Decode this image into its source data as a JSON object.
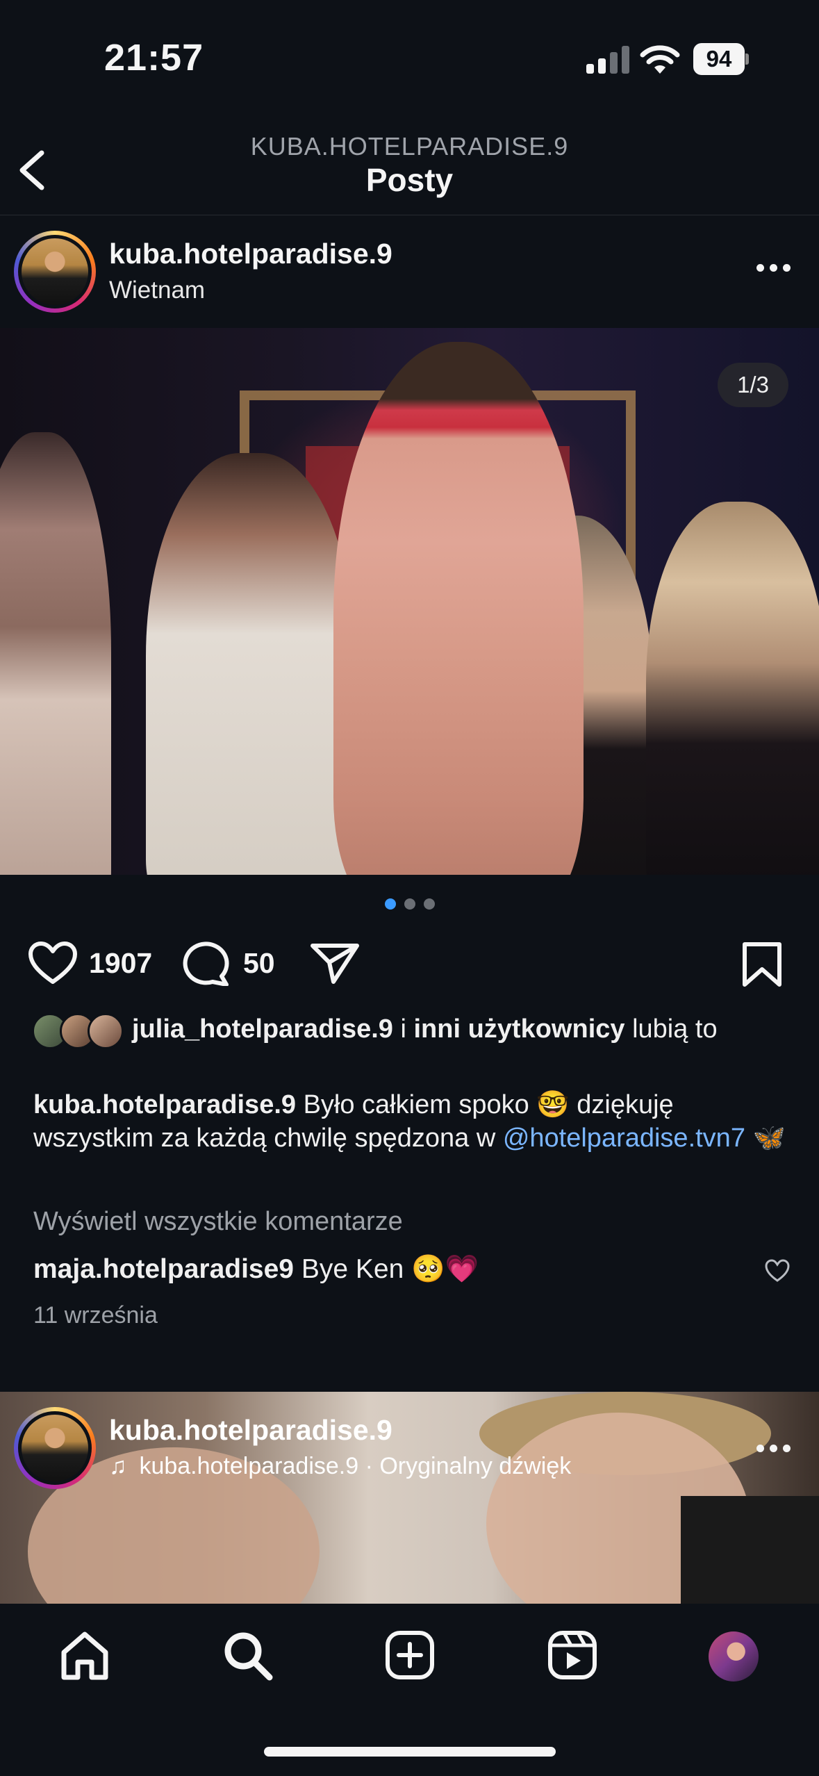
{
  "status_bar": {
    "time": "21:57",
    "battery": "94"
  },
  "nav": {
    "subtitle": "KUBA.HOTELPARADISE.9",
    "title": "Posty"
  },
  "post": {
    "username": "kuba.hotelparadise.9",
    "location": "Wietnam",
    "page_indicator": "1/3",
    "likes_count": "1907",
    "comments_count": "50",
    "likes_line": {
      "user": "julia_hotelparadise.9",
      "connector": " i ",
      "others": "inni użytkownicy",
      "suffix": " lubią to"
    },
    "caption": {
      "username": "kuba.hotelparadise.9",
      "text": " Było całkiem spoko 🤓 dziękuję wszystkim za każdą chwilę spędzona w ",
      "mention": "@hotelparadise.tvn7",
      "tail": " 🦋"
    },
    "view_all_comments": "Wyświetl wszystkie komentarze",
    "top_comment": {
      "username": "maja.hotelparadise9",
      "text": " Bye Ken 🥺💗"
    },
    "date": "11 września"
  },
  "post2": {
    "username": "kuba.hotelparadise.9",
    "audio": "kuba.hotelparadise.9 · Oryginalny dźwięk"
  },
  "icons": [
    "back-icon",
    "more-icon",
    "heart-icon",
    "comment-icon",
    "share-icon",
    "bookmark-icon",
    "home-icon",
    "search-icon",
    "create-icon",
    "reels-icon",
    "profile-avatar"
  ]
}
